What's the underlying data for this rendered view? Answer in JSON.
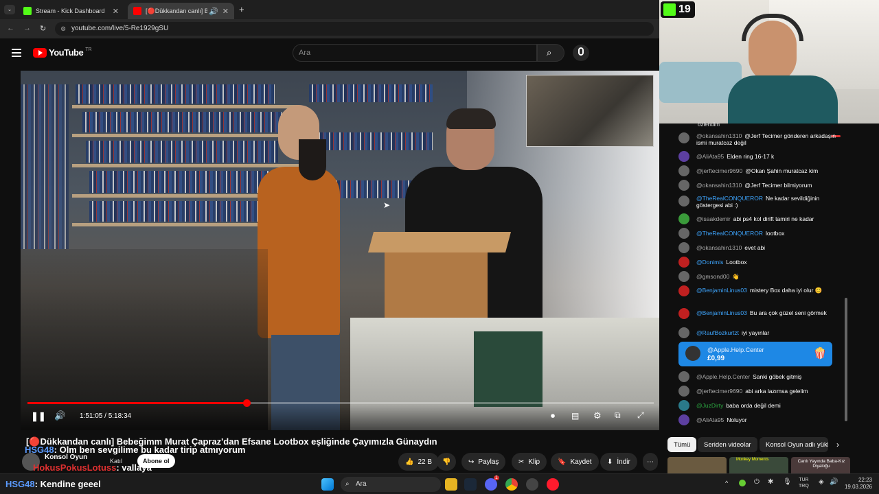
{
  "browser": {
    "tabs": [
      {
        "label": "Stream - Kick Dashboard",
        "icon": "kick-icon",
        "active": false
      },
      {
        "label": "[🔴Dükkandan canlı] Bebe",
        "icon": "youtube-icon",
        "active": true
      }
    ],
    "url": "youtube.com/live/5-Re1929gSU"
  },
  "youtube": {
    "logo": "YouTube",
    "region": "TR",
    "search_placeholder": "Ara"
  },
  "player": {
    "time": "1:51:05 / 5:18:34",
    "progress": 0.35
  },
  "video_title": "[🔴Dükkandan canlı] Bebeğimm Murat Çapraz'dan Efsane Lootbox eşliğinde Çayımızla Günaydın",
  "channel": {
    "name": "Konsol Oyun",
    "join_label": "Katıl",
    "subscribe_label": "Abone ol"
  },
  "overlay_chat": [
    {
      "user": "HSG48",
      "text": ": Olm ben sevgilime bu kadar tirip atmıyorum"
    },
    {
      "user": "HokusPokusLotuss",
      "text": ": vallaya"
    },
    {
      "user": "HSG48",
      "text": ": Kendine geeel"
    }
  ],
  "actions": {
    "likes": "22 B",
    "share": "Paylaş",
    "clip": "Klip",
    "save": "Kaydet",
    "download": "İndir"
  },
  "kick_badge": {
    "count": "19"
  },
  "chat": {
    "top_fragment": "özlendim",
    "messages": [
      {
        "author": "@okansahin1310",
        "text": "@Jerf Tecimer gönderen arkadaşın ismi muratcaz değil"
      },
      {
        "author": "@AliAta95",
        "text": "Elden ring 16-17 k"
      },
      {
        "author": "@jerftecimer9690",
        "text": "@Okan Şahin muratcaz kim"
      },
      {
        "author": "@okansahin1310",
        "text": "@Jerf Tecimer bilmiyorum"
      },
      {
        "author": "@TheRealCONQUEROR",
        "text": "Ne kadar sevildiğinin göstergesi abi :)"
      },
      {
        "author": "@isaakdemir",
        "text": "abi ps4 kol dirift tamiri ne kadar"
      },
      {
        "author": "@TheRealCONQUEROR",
        "text": "lootbox"
      },
      {
        "author": "@okansahin1310",
        "text": "evet abi"
      },
      {
        "author": "@Donimis",
        "text": "Lootbox"
      },
      {
        "author": "@gmsond00",
        "text": "👋"
      },
      {
        "author": "@BenjaminLinus03",
        "text": "mistery Box daha iyi olur 😊"
      },
      {
        "author": "@BenjaminLinus03",
        "text": "Bu ara çok güzel seni görmek"
      },
      {
        "author": "@RaufBozkurtzt",
        "text": "iyi yayınlar"
      },
      {
        "author": "@Apple.Help.Center",
        "text": "Sanki göbek gitmiş"
      },
      {
        "author": "@jerftecimer9690",
        "text": "abi arka lazımsa gelelim"
      },
      {
        "author": "@JuzDirty",
        "text": "baba orda değil demi"
      },
      {
        "author": "@AliAta95",
        "text": "Noluyor"
      }
    ],
    "superchat": {
      "author": "@Apple.Help.Center",
      "amount": "£0,99"
    },
    "chips": [
      "Tümü",
      "Seriden videolar",
      "Konsol Oyun adlı yükl"
    ],
    "thumb_labels": [
      "Monkey Moments",
      "Canlı Yayında Baba-Kız Diyaloğu"
    ]
  },
  "taskbar": {
    "search": "Ara",
    "lang": "TUR",
    "lang2": "TRQ",
    "time": "22:23",
    "date": "19.03.2026",
    "mail_badge": "1"
  }
}
